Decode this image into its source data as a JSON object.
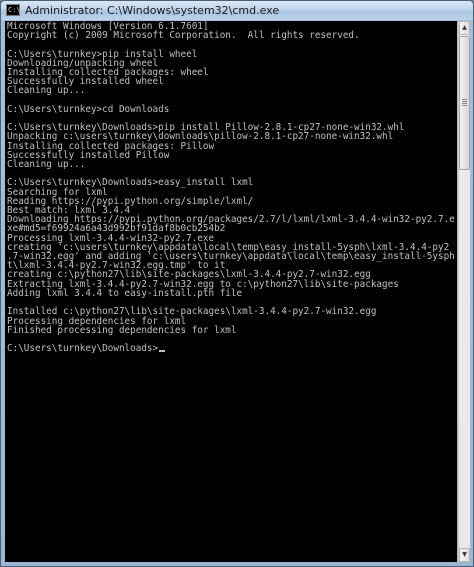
{
  "window": {
    "title": "Administrator: C:\\Windows\\system32\\cmd.exe",
    "icon": "cmd-icon"
  },
  "console": {
    "lines": [
      "Microsoft Windows [Version 6.1.7601]",
      "Copyright (c) 2009 Microsoft Corporation.  All rights reserved.",
      "",
      "C:\\Users\\turnkey>pip install wheel",
      "Downloading/unpacking wheel",
      "Installing collected packages: wheel",
      "Successfully installed wheel",
      "Cleaning up...",
      "",
      "C:\\Users\\turnkey>cd Downloads",
      "",
      "C:\\Users\\turnkey\\Downloads>pip install Pillow-2.8.1-cp27-none-win32.whl",
      "Unpacking c:\\users\\turnkey\\downloads\\pillow-2.8.1-cp27-none-win32.whl",
      "Installing collected packages: Pillow",
      "Successfully installed Pillow",
      "Cleaning up...",
      "",
      "C:\\Users\\turnkey\\Downloads>easy_install lxml",
      "Searching for lxml",
      "Reading https://pypi.python.org/simple/lxml/",
      "Best match: lxml 3.4.4",
      "Downloading https://pypi.python.org/packages/2.7/l/lxml/lxml-3.4.4-win32-py2.7.e",
      "xe#md5=f69924a6a43d992bf91daf8b0cb254b2",
      "Processing lxml-3.4.4-win32-py2.7.exe",
      "creating 'c:\\users\\turnkey\\appdata\\local\\temp\\easy_install-5ysph\\lxml-3.4.4-py2",
      ".7-win32.egg' and adding 'c:\\users\\turnkey\\appdata\\local\\temp\\easy_install-5ysph",
      "t\\lxml-3.4.4-py2.7-win32.egg.tmp' to it",
      "creating c:\\python27\\lib\\site-packages\\lxml-3.4.4-py2.7-win32.egg",
      "Extracting lxml-3.4.4-py2.7-win32.egg to c:\\python27\\lib\\site-packages",
      "Adding lxml 3.4.4 to easy-install.pth file",
      "",
      "Installed c:\\python27\\lib\\site-packages\\lxml-3.4.4-py2.7-win32.egg",
      "Processing dependencies for lxml",
      "Finished processing dependencies for lxml",
      "",
      "C:\\Users\\turnkey\\Downloads>"
    ]
  },
  "colors": {
    "console_bg": "#000000",
    "console_fg": "#c0c0c0"
  },
  "scrollbar": {
    "position_fraction": 0
  }
}
